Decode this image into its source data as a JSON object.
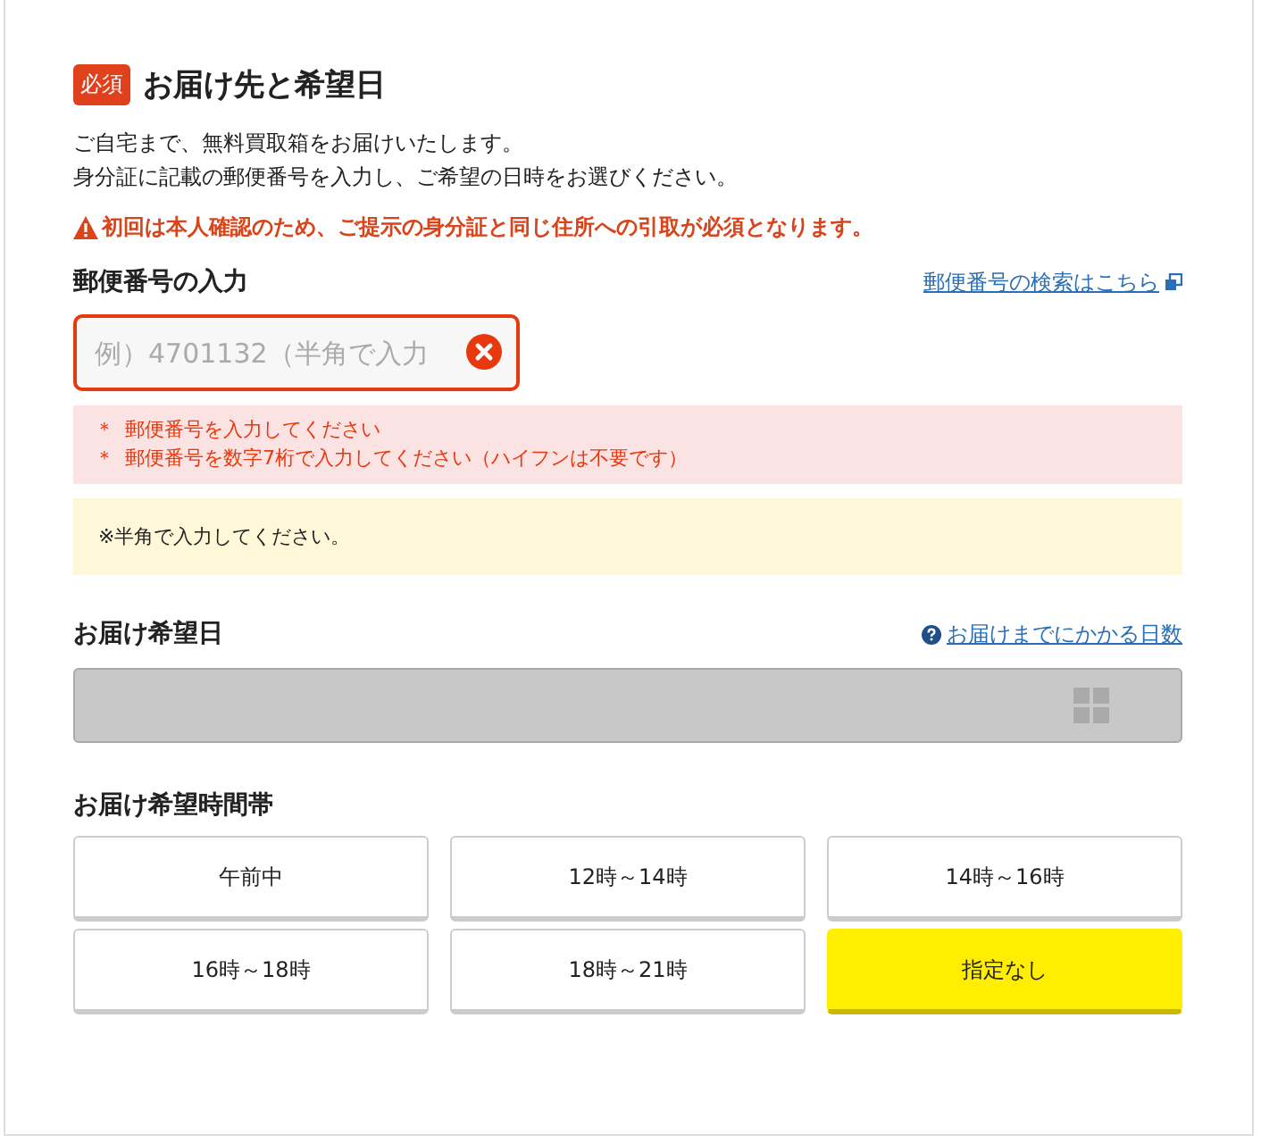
{
  "section": {
    "badge": "必須",
    "title": "お届け先と希望日"
  },
  "intro": [
    "ご自宅まで、無料買取箱をお届けいたします。",
    "身分証に記載の郵便番号を入力し、ご希望の日時をお選びください。"
  ],
  "warning": "初回は本人確認のため、ご提示の身分証と同じ住所への引取が必須となります。",
  "postal": {
    "label": "郵便番号の入力",
    "link": "郵便番号の検索はこちら",
    "placeholder": "例）4701132（半角で入力",
    "error": true,
    "errors": [
      {
        "mark": "＊",
        "text": "郵便番号を入力してください"
      },
      {
        "mark": "＊",
        "text": "郵便番号を数字7桁で入力してください（ハイフンは不要です）"
      }
    ],
    "note": "※半角で入力してください。"
  },
  "date": {
    "label": "お届け希望日",
    "link": "お届けまでにかかる日数",
    "disabled": true
  },
  "time": {
    "label": "お届け希望時間帯",
    "options": [
      {
        "label": "午前中",
        "selected": false
      },
      {
        "label": "12時～14時",
        "selected": false
      },
      {
        "label": "14時～16時",
        "selected": false
      },
      {
        "label": "16時～18時",
        "selected": false
      },
      {
        "label": "18時～21時",
        "selected": false
      },
      {
        "label": "指定なし",
        "selected": true
      }
    ]
  }
}
